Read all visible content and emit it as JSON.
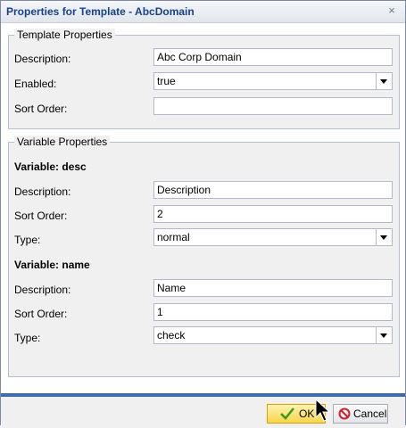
{
  "dialog": {
    "title": "Properties for Template - AbcDomain",
    "close_glyph": "×"
  },
  "template_properties": {
    "legend": "Template Properties",
    "description_label": "Description:",
    "description_value": "Abc Corp Domain",
    "enabled_label": "Enabled:",
    "enabled_value": "true",
    "sort_order_label": "Sort Order:",
    "sort_order_value": ""
  },
  "variable_properties": {
    "legend": "Variable Properties",
    "variables": [
      {
        "title": "Variable: desc",
        "description_label": "Description:",
        "description_value": "Description",
        "sort_order_label": "Sort Order:",
        "sort_order_value": "2",
        "type_label": "Type:",
        "type_value": "normal"
      },
      {
        "title": "Variable: name",
        "description_label": "Description:",
        "description_value": "Name",
        "sort_order_label": "Sort Order:",
        "sort_order_value": "1",
        "type_label": "Type:",
        "type_value": "check"
      }
    ]
  },
  "footer": {
    "ok_label": "OK",
    "cancel_label": "Cancel"
  },
  "colors": {
    "title_text": "#15428b",
    "section_rule": "#2b5cae",
    "ok_button": "#f8d54a",
    "ok_check_icon": "#3a9a1c",
    "cancel_icon": "#d0202a"
  },
  "icons": {
    "close": "close-icon",
    "dropdown": "chevron-down-icon",
    "ok": "check-icon",
    "cancel": "no-entry-icon",
    "pointer": "mouse-cursor-icon"
  }
}
